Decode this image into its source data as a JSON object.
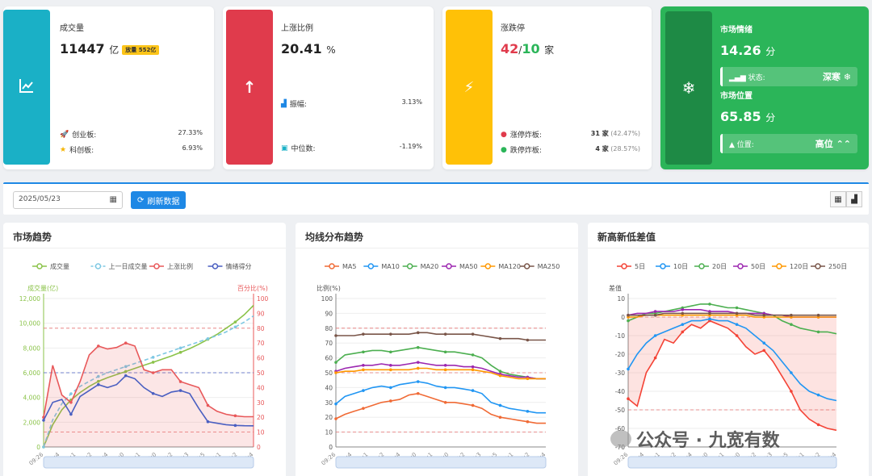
{
  "cards": {
    "volume": {
      "title": "成交量",
      "value": "11447",
      "unit": "亿",
      "badge": "放量 552亿",
      "rows": [
        {
          "label": "创业板:",
          "value": "27.33%"
        },
        {
          "label": "科创板:",
          "value": "6.93%"
        }
      ],
      "color": "#1ab0c6"
    },
    "rise": {
      "title": "上涨比例",
      "value": "20.41",
      "unit": "%",
      "rows": [
        {
          "label": "振幅:",
          "value": "3.13%"
        },
        {
          "label": "中位数:",
          "value": "-1.19%"
        }
      ],
      "color": "#e03b4c"
    },
    "limit": {
      "title": "涨跌停",
      "up": "42",
      "sep": "/",
      "down": "10",
      "unit": "家",
      "rows": [
        {
          "label": "涨停炸板:",
          "value": "31 家",
          "sub": "(42.47%)"
        },
        {
          "label": "跌停炸板:",
          "value": "4 家",
          "sub": "(28.57%)"
        }
      ],
      "color": "#ffc107"
    },
    "sentiment": {
      "title": "市场情绪",
      "value": "14.26",
      "unit": "分",
      "status_label": "状态:",
      "status_value": "深寒 ❄",
      "pos_title": "市场位置",
      "pos_value": "65.85",
      "pos_unit": "分",
      "pos_label": "位置:",
      "pos_status": "高位 ⌃⌃",
      "color": "#2bb559"
    }
  },
  "toolbar": {
    "date": "2025/05/23",
    "refresh_label": "刷新数据"
  },
  "panels": {
    "trend": {
      "title": "市场趋势"
    },
    "ma": {
      "title": "均线分布趋势"
    },
    "highlow": {
      "title": "新高新低差值"
    }
  },
  "watermark": "公众号 · 九宽有数",
  "chart_data": [
    {
      "type": "line",
      "title": "市场趋势",
      "legend": [
        "成交量",
        "上一日成交量",
        "上涨比例",
        "情绪得分"
      ],
      "ylabel_left": "成交量(亿)",
      "ylabel_right": "百分比(%)",
      "ylim_left": [
        0,
        12000
      ],
      "ylim_right": [
        0,
        100
      ],
      "yticks_left": [
        "0",
        "2,000",
        "4,000",
        "6,000",
        "8,000",
        "10,000",
        "12,000"
      ],
      "yticks_right": [
        "0",
        "10",
        "20",
        "30",
        "40",
        "50",
        "60",
        "70",
        "80",
        "90",
        "100"
      ],
      "xticks": [
        "09:26",
        "09:4",
        "10:1",
        "10:2",
        "10:4",
        "11:0",
        "11:1",
        "13:0",
        "13:2",
        "13:3",
        "13:5",
        "14:1",
        "14:2",
        "14:4"
      ],
      "hlines_right": [
        10,
        50,
        80
      ],
      "series": [
        {
          "name": "成交量",
          "axis": "left",
          "color": "#8bc34a",
          "values": [
            0,
            1800,
            3000,
            3800,
            4400,
            4900,
            5300,
            5600,
            5850,
            6100,
            6350,
            6600,
            6850,
            7100,
            7350,
            7650,
            7950,
            8300,
            8700,
            9100,
            9600,
            10100,
            10700,
            11447
          ]
        },
        {
          "name": "上一日成交量",
          "axis": "left",
          "color": "#7ec8e3",
          "dashed": true,
          "values": [
            0,
            2200,
            3500,
            4300,
            4900,
            5300,
            5700,
            6000,
            6250,
            6500,
            6750,
            7000,
            7250,
            7500,
            7750,
            8000,
            8250,
            8500,
            8750,
            9000,
            9300,
            9700,
            10100,
            10600
          ]
        },
        {
          "name": "上涨比例",
          "axis": "right",
          "color": "#e8585a",
          "values": [
            20,
            55,
            35,
            30,
            44,
            62,
            68,
            66,
            67,
            70,
            68,
            52,
            50,
            52,
            52,
            44,
            42,
            40,
            28,
            24,
            22,
            21,
            20.4,
            20.4
          ]
        },
        {
          "name": "情绪得分",
          "axis": "right",
          "color": "#4a5fc1",
          "values": [
            18,
            30,
            32,
            22,
            34,
            38,
            42,
            40,
            42,
            48,
            46,
            40,
            36,
            34,
            37,
            38,
            36,
            26,
            17,
            16,
            15,
            14.5,
            14.3,
            14.26
          ]
        }
      ]
    },
    {
      "type": "line",
      "title": "均线分布趋势",
      "legend": [
        "MA5",
        "MA10",
        "MA20",
        "MA50",
        "MA120",
        "MA250"
      ],
      "ylabel": "比例(%)",
      "ylim": [
        0,
        100
      ],
      "yticks": [
        "0",
        "10",
        "20",
        "30",
        "40",
        "50",
        "60",
        "70",
        "80",
        "90",
        "100"
      ],
      "xticks": [
        "09:26",
        "09:4",
        "10:1",
        "10:2",
        "10:4",
        "11:0",
        "11:1",
        "13:0",
        "13:2",
        "13:3",
        "13:5",
        "14:1",
        "14:2",
        "14:4"
      ],
      "hlines": [
        10,
        50,
        80
      ],
      "series": [
        {
          "name": "MA5",
          "color": "#f06a35",
          "values": [
            19,
            22,
            24,
            26,
            28,
            30,
            31,
            32,
            35,
            36,
            34,
            32,
            30,
            30,
            29,
            28,
            26,
            22,
            20,
            19,
            18,
            17,
            16,
            16
          ]
        },
        {
          "name": "MA10",
          "color": "#2196f3",
          "values": [
            29,
            34,
            36,
            38,
            40,
            41,
            40,
            42,
            43,
            44,
            43,
            41,
            40,
            40,
            39,
            38,
            36,
            30,
            28,
            26,
            25,
            24,
            23,
            23
          ]
        },
        {
          "name": "MA20",
          "color": "#4caf50",
          "values": [
            57,
            62,
            63,
            64,
            65,
            65,
            64,
            65,
            66,
            67,
            66,
            65,
            64,
            64,
            63,
            62,
            60,
            55,
            51,
            49,
            48,
            47,
            46,
            46
          ]
        },
        {
          "name": "MA50",
          "color": "#9c27b0",
          "values": [
            51,
            53,
            54,
            55,
            55,
            56,
            55,
            55,
            56,
            57,
            56,
            55,
            55,
            55,
            54,
            54,
            53,
            51,
            49,
            48,
            47,
            47,
            46,
            46
          ]
        },
        {
          "name": "MA120",
          "color": "#ff9800",
          "values": [
            50,
            51,
            51,
            52,
            52,
            52,
            52,
            52,
            52,
            53,
            53,
            52,
            52,
            52,
            52,
            52,
            51,
            50,
            48,
            47,
            46,
            46,
            46,
            46
          ]
        },
        {
          "name": "MA250",
          "color": "#795548",
          "values": [
            75,
            75,
            75,
            76,
            76,
            76,
            76,
            76,
            76,
            77,
            77,
            76,
            76,
            76,
            76,
            76,
            75,
            74,
            73,
            73,
            73,
            72,
            72,
            72
          ]
        }
      ]
    },
    {
      "type": "line",
      "title": "新高新低差值",
      "legend": [
        "5日",
        "10日",
        "20日",
        "50日",
        "120日",
        "250日"
      ],
      "ylabel": "差值",
      "ylim": [
        -70,
        10
      ],
      "yticks": [
        "-70",
        "-60",
        "-50",
        "-40",
        "-30",
        "-20",
        "-10",
        "0",
        "10"
      ],
      "xticks": [
        "09:26",
        "09:4",
        "10:1",
        "10:2",
        "10:4",
        "11:0",
        "11:1",
        "13:0",
        "13:2",
        "13:3",
        "13:5",
        "14:1",
        "14:2",
        "14:4"
      ],
      "hlines": [
        -50,
        0
      ],
      "series": [
        {
          "name": "5日",
          "color": "#f44336",
          "values": [
            -44,
            -48,
            -30,
            -22,
            -12,
            -14,
            -8,
            -4,
            -6,
            -2,
            -4,
            -6,
            -10,
            -16,
            -20,
            -18,
            -24,
            -32,
            -40,
            -50,
            -55,
            -58,
            -60,
            -61
          ]
        },
        {
          "name": "10日",
          "color": "#2196f3",
          "values": [
            -28,
            -20,
            -14,
            -10,
            -8,
            -6,
            -4,
            -2,
            -2,
            -1,
            -2,
            -2,
            -4,
            -6,
            -10,
            -14,
            -18,
            -24,
            -30,
            -36,
            -40,
            -42,
            -44,
            -45
          ]
        },
        {
          "name": "20日",
          "color": "#4caf50",
          "values": [
            -2,
            0,
            2,
            2,
            3,
            4,
            5,
            6,
            7,
            7,
            6,
            5,
            5,
            4,
            3,
            2,
            1,
            -2,
            -4,
            -6,
            -7,
            -8,
            -8,
            -9
          ]
        },
        {
          "name": "50日",
          "color": "#9c27b0",
          "values": [
            1,
            2,
            2,
            3,
            3,
            3,
            4,
            4,
            4,
            3,
            3,
            3,
            2,
            2,
            2,
            2,
            1,
            1,
            0,
            0,
            0,
            0,
            0,
            0
          ]
        },
        {
          "name": "120日",
          "color": "#ff9800",
          "values": [
            0,
            0,
            1,
            1,
            1,
            1,
            1,
            1,
            1,
            1,
            1,
            1,
            1,
            1,
            0,
            0,
            0,
            0,
            0,
            0,
            0,
            0,
            0,
            0
          ]
        },
        {
          "name": "250日",
          "color": "#795548",
          "values": [
            1,
            1,
            1,
            1,
            2,
            2,
            2,
            2,
            2,
            2,
            2,
            2,
            2,
            2,
            1,
            1,
            1,
            1,
            1,
            1,
            1,
            1,
            1,
            1
          ]
        }
      ]
    }
  ]
}
